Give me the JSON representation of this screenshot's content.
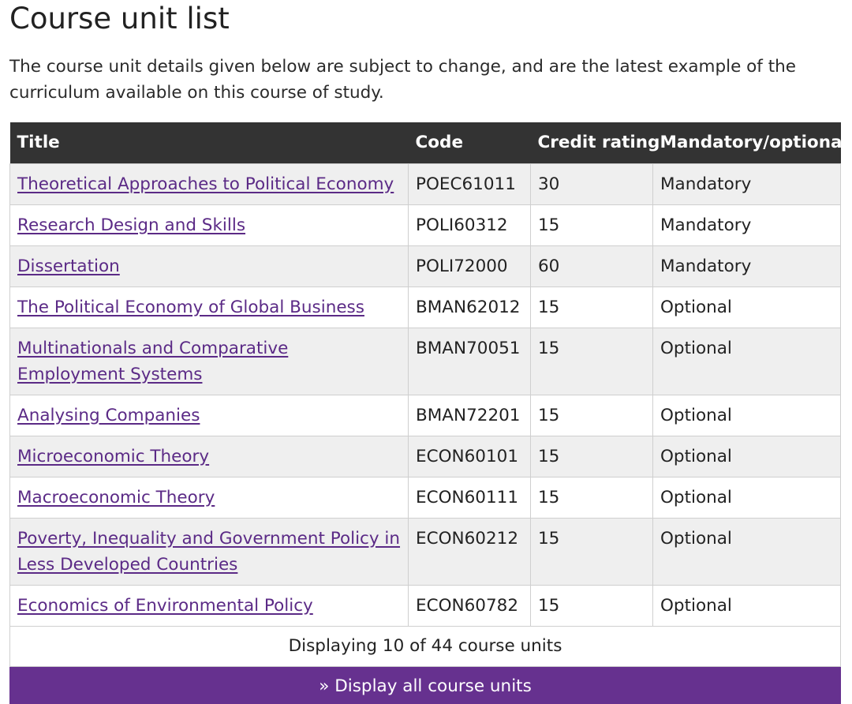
{
  "page": {
    "title": "Course unit list",
    "intro": "The course unit details given below are subject to change, and are the latest example of the curriculum available on this course of study."
  },
  "table": {
    "headers": [
      "Title",
      "Code",
      "Credit rating",
      "Mandatory/optional"
    ],
    "rows": [
      {
        "title": "Theoretical Approaches to Political Economy",
        "code": "POEC61011",
        "credits": "30",
        "status": "Mandatory"
      },
      {
        "title": "Research Design and Skills",
        "code": "POLI60312",
        "credits": "15",
        "status": "Mandatory"
      },
      {
        "title": "Dissertation",
        "code": "POLI72000",
        "credits": "60",
        "status": "Mandatory"
      },
      {
        "title": "The Political Economy of Global Business",
        "code": "BMAN62012",
        "credits": "15",
        "status": "Optional"
      },
      {
        "title": "Multinationals and Comparative Employment Systems",
        "code": "BMAN70051",
        "credits": "15",
        "status": "Optional"
      },
      {
        "title": "Analysing Companies",
        "code": "BMAN72201",
        "credits": "15",
        "status": "Optional"
      },
      {
        "title": "Microeconomic Theory",
        "code": "ECON60101",
        "credits": "15",
        "status": "Optional"
      },
      {
        "title": "Macroeconomic Theory",
        "code": "ECON60111",
        "credits": "15",
        "status": "Optional"
      },
      {
        "title": "Poverty, Inequality and Government Policy in Less Developed Countries",
        "code": "ECON60212",
        "credits": "15",
        "status": "Optional"
      },
      {
        "title": "Economics of Environmental Policy",
        "code": "ECON60782",
        "credits": "15",
        "status": "Optional"
      }
    ],
    "footer": "Displaying 10 of 44 course units",
    "display_all": "» Display all course units"
  },
  "colors": {
    "header_bg": "#333333",
    "link": "#5b2a86",
    "accent": "#66318f",
    "row_alt": "#efefef"
  }
}
